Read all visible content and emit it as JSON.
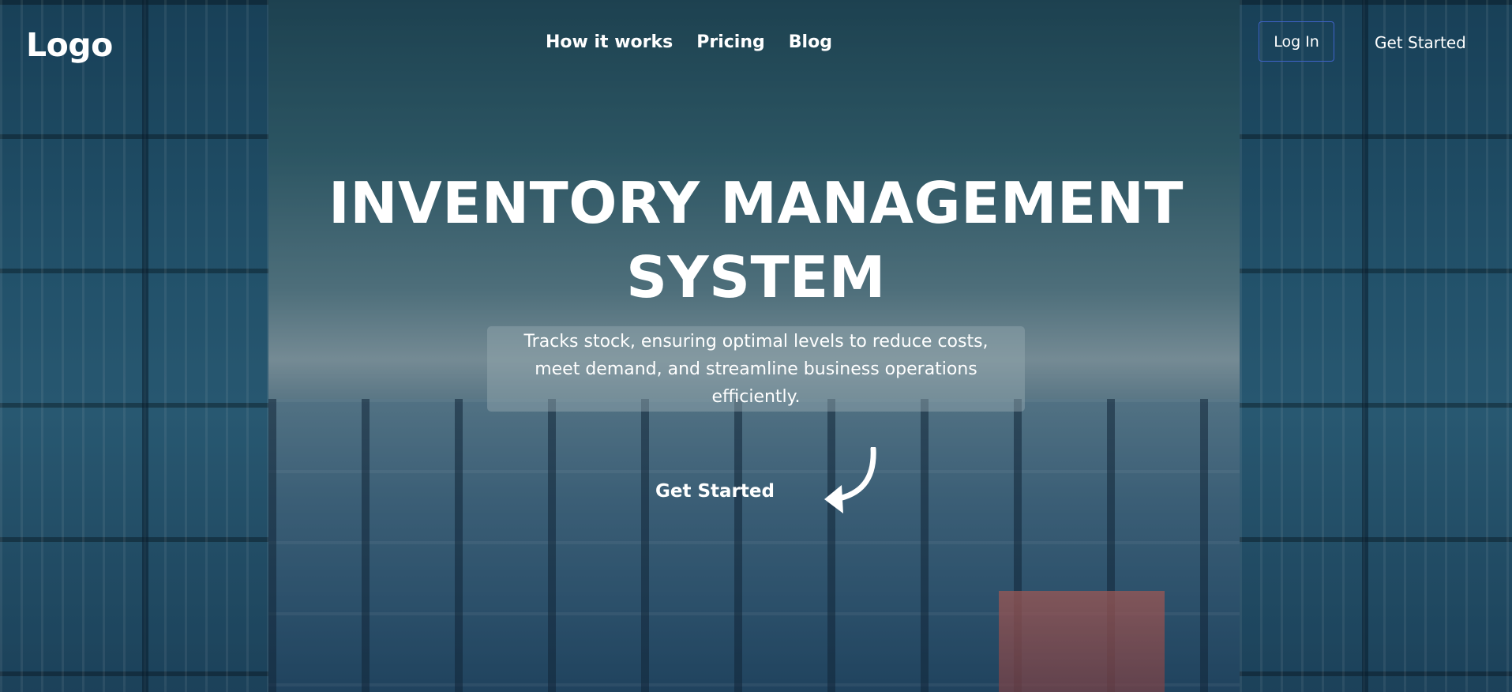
{
  "nav": {
    "logo": "Logo",
    "links": [
      "How it works",
      "Pricing",
      "Blog"
    ],
    "login_label": "Log In",
    "cta_label": "Get Started"
  },
  "hero": {
    "title_line1": "INVENTORY MANAGEMENT",
    "title_line2": "SYSTEM",
    "subtitle": "Tracks stock, ensuring optimal levels to reduce costs, meet demand, and streamline business operations efficiently.",
    "cta_label": "Get Started",
    "cta_icon": "curved-arrow-icon"
  },
  "colors": {
    "text": "#ffffff",
    "login_border": "#3f63c9",
    "subtitle_box": "rgba(150,170,178,0.45)"
  }
}
